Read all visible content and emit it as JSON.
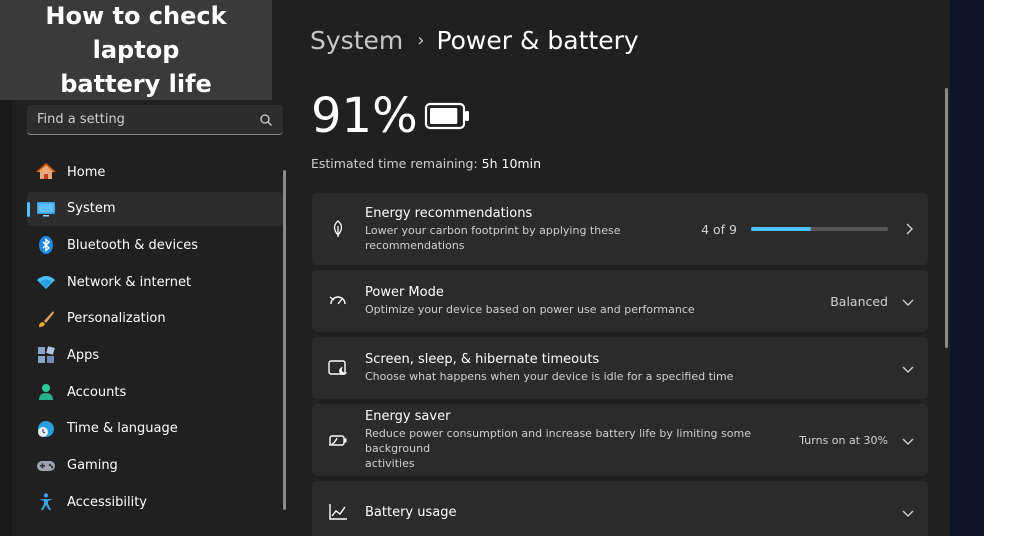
{
  "banner": {
    "line1": "How to check laptop",
    "line2": "battery life"
  },
  "search": {
    "placeholder": "Find a setting",
    "icon": "search-icon"
  },
  "sidebar": {
    "items": [
      {
        "label": "Home",
        "icon": "home-icon"
      },
      {
        "label": "System",
        "icon": "system-icon",
        "active": true
      },
      {
        "label": "Bluetooth & devices",
        "icon": "bluetooth-icon"
      },
      {
        "label": "Network & internet",
        "icon": "wifi-icon"
      },
      {
        "label": "Personalization",
        "icon": "brush-icon"
      },
      {
        "label": "Apps",
        "icon": "apps-icon"
      },
      {
        "label": "Accounts",
        "icon": "accounts-icon"
      },
      {
        "label": "Time & language",
        "icon": "globe-clock-icon"
      },
      {
        "label": "Gaming",
        "icon": "gamepad-icon"
      },
      {
        "label": "Accessibility",
        "icon": "accessibility-icon"
      }
    ]
  },
  "breadcrumb": {
    "parent": "System",
    "separator": "›",
    "current": "Power & battery"
  },
  "battery": {
    "percent_text": "91%",
    "level": 0.91,
    "estimate_label": "Estimated time remaining:",
    "estimate_value": "5h 10min"
  },
  "cards": {
    "energy_rec": {
      "title": "Energy recommendations",
      "desc_line1": "Lower your carbon footprint by applying these",
      "desc_line2": "recommendations",
      "progress_text": "4 of 9",
      "progress_fraction": 0.44
    },
    "power_mode": {
      "title": "Power Mode",
      "desc": "Optimize your device based on power use and performance",
      "value": "Balanced"
    },
    "screen_sleep": {
      "title": "Screen, sleep, & hibernate timeouts",
      "desc": "Choose what happens when your device is idle for a specified time"
    },
    "energy_saver": {
      "title": "Energy saver",
      "desc_line1": "Reduce power consumption and increase battery life by limiting some background",
      "desc_line2": "activities",
      "value": "Turns on at 30%"
    },
    "battery_usage": {
      "title": "Battery usage"
    }
  },
  "colors": {
    "accent": "#4cc2ff",
    "window_bg": "#202020",
    "card_bg": "#2b2b2b"
  }
}
